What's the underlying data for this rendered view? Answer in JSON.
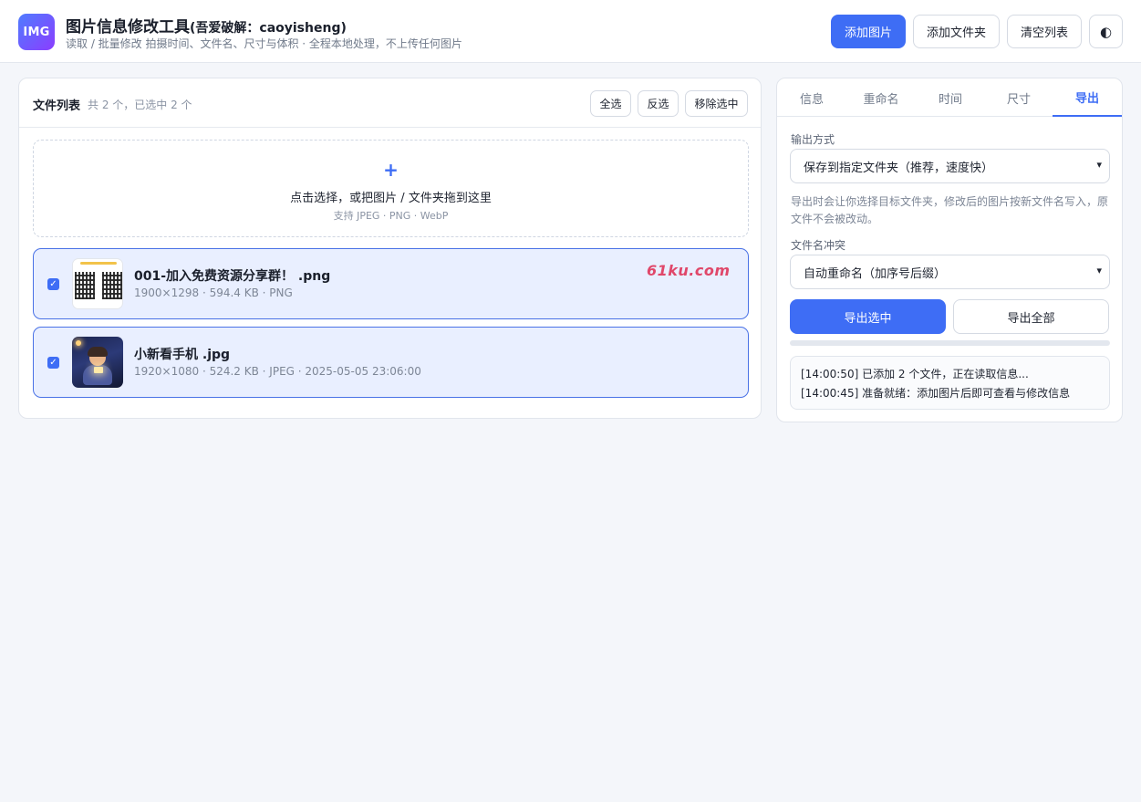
{
  "header": {
    "logo_text": "IMG",
    "title": "图片信息修改工具",
    "title_suffix": "(吾爱破解：caoyisheng)",
    "subtitle": "读取 / 批量修改 拍摄时间、文件名、尺寸与体积 · 全程本地处理，不上传任何图片",
    "buttons": {
      "add_image": "添加图片",
      "add_folder": "添加文件夹",
      "clear_list": "清空列表",
      "theme_toggle": "◐"
    }
  },
  "file_list": {
    "title": "文件列表",
    "count_text": "共 2 个，已选中 2 个",
    "select_all": "全选",
    "invert": "反选",
    "remove_selected": "移除选中",
    "dropzone": {
      "plus": "+",
      "main": "点击选择，或把图片 / 文件夹拖到这里",
      "sub": "支持 JPEG · PNG · WebP"
    },
    "files": [
      {
        "name": "001-加入免费资源分享群！ .png",
        "meta": "1900×1298 · 594.4 KB · PNG",
        "checked": true,
        "thumb_icon": "qr-code-thumbnail"
      },
      {
        "name": "小新看手机 .jpg",
        "meta": "1920×1080 · 524.2 KB · JPEG · 2025-05-05 23:06:00",
        "checked": true,
        "thumb_icon": "illustration-thumbnail"
      }
    ],
    "watermark": "61ku.com"
  },
  "side_panel": {
    "tabs": [
      "信息",
      "重命名",
      "时间",
      "尺寸",
      "导出"
    ],
    "active_tab": "导出",
    "output_mode_label": "输出方式",
    "output_mode_value": "保存到指定文件夹（推荐，速度快）",
    "hint": "导出时会让你选择目标文件夹，修改后的图片按新文件名写入，原文件不会被改动。",
    "conflict_label": "文件名冲突",
    "conflict_value": "自动重命名（加序号后缀）",
    "export_selected": "导出选中",
    "export_all": "导出全部",
    "progress": 0,
    "log": [
      "[14:00:50] 已添加 2 个文件，正在读取信息...",
      "[14:00:45] 准备就绪：添加图片后即可查看与修改信息"
    ]
  },
  "colors": {
    "accent": "#3e6df5",
    "selected_row_bg": "#e9efff",
    "watermark": "#e0476a"
  }
}
